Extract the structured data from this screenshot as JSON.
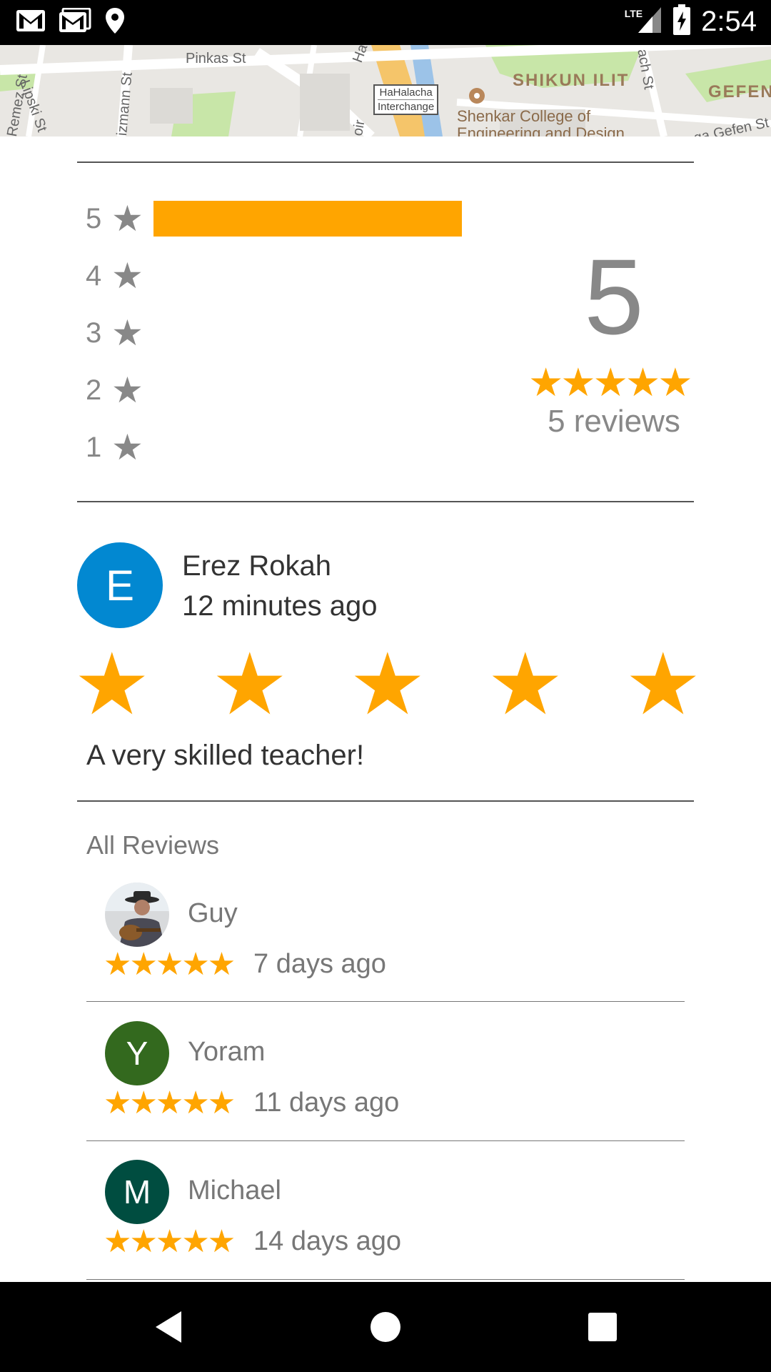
{
  "status_bar": {
    "time": "2:54",
    "network": "LTE",
    "icons": [
      "gmail-icon",
      "gmail-outline-icon",
      "location-pin-icon",
      "signal-icon",
      "battery-charging-icon"
    ]
  },
  "map": {
    "streets": [
      "Pinkas St",
      "Remez St",
      "Lipski St",
      "izmann St",
      "Ha",
      "ach St",
      "ga Gefen St",
      "oir"
    ],
    "district": "SHIKUN ILIT",
    "district_right": "GEFEN",
    "interchange": [
      "HaHalacha",
      "Interchange"
    ],
    "college": [
      "Shenkar College of",
      "Engineering and Design"
    ]
  },
  "rating_summary": {
    "histogram": [
      {
        "stars": "5",
        "fraction": 1.0
      },
      {
        "stars": "4",
        "fraction": 0
      },
      {
        "stars": "3",
        "fraction": 0
      },
      {
        "stars": "2",
        "fraction": 0
      },
      {
        "stars": "1",
        "fraction": 0
      }
    ],
    "average": "5",
    "stars": "★★★★★",
    "count_label": "5 reviews",
    "bar_color": "#FFA500"
  },
  "my_review": {
    "avatar_letter": "E",
    "avatar_color": "#0288D1",
    "name": "Erez Rokah",
    "time": "12 minutes ago",
    "rating": 5,
    "text": "A very skilled teacher!"
  },
  "all_reviews": {
    "title": "All Reviews",
    "items": [
      {
        "name": "Guy",
        "avatar": "photo",
        "stars": "★★★★★",
        "time": "7 days ago"
      },
      {
        "name": "Yoram",
        "avatar_letter": "Y",
        "avatar_color": "#33691E",
        "stars": "★★★★★",
        "time": "11 days ago"
      },
      {
        "name": "Michael",
        "avatar_letter": "M",
        "avatar_color": "#004D40",
        "stars": "★★★★★",
        "time": "14 days ago"
      }
    ]
  },
  "nav_bar": {
    "buttons": [
      "back-icon",
      "home-icon",
      "recents-icon"
    ]
  }
}
